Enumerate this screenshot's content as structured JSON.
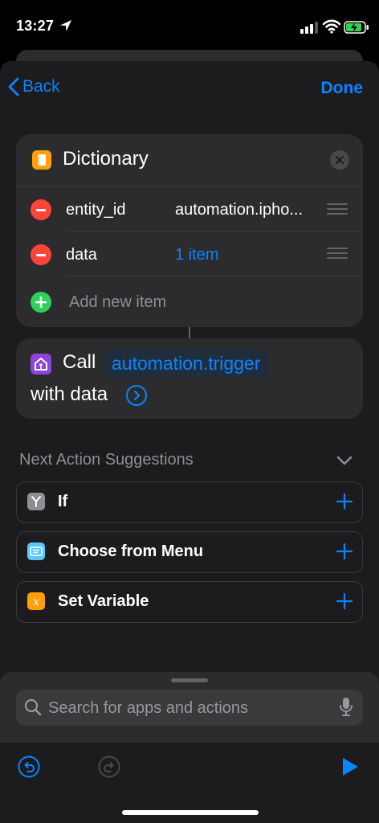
{
  "status_bar": {
    "time": "13:27"
  },
  "nav": {
    "back_label": "Back",
    "done_label": "Done"
  },
  "dictionary": {
    "title": "Dictionary",
    "items": [
      {
        "key": "entity_id",
        "value": "automation.ipho..."
      },
      {
        "key": "data",
        "value": "1 item"
      }
    ],
    "add_label": "Add new item"
  },
  "call_action": {
    "verb": "Call",
    "service": "automation.trigger",
    "suffix": "with data"
  },
  "suggestions": {
    "title": "Next Action Suggestions",
    "items": [
      {
        "label": "If",
        "icon": "if-icon",
        "color": "#8e8e93"
      },
      {
        "label": "Choose from Menu",
        "icon": "menu-icon",
        "color": "#5ac8fa"
      },
      {
        "label": "Set Variable",
        "icon": "variable-icon",
        "color": "#ff9f0a"
      }
    ]
  },
  "search": {
    "placeholder": "Search for apps and actions"
  },
  "colors": {
    "accent": "#0a84ff",
    "destructive": "#ff453a",
    "add": "#30d158"
  }
}
